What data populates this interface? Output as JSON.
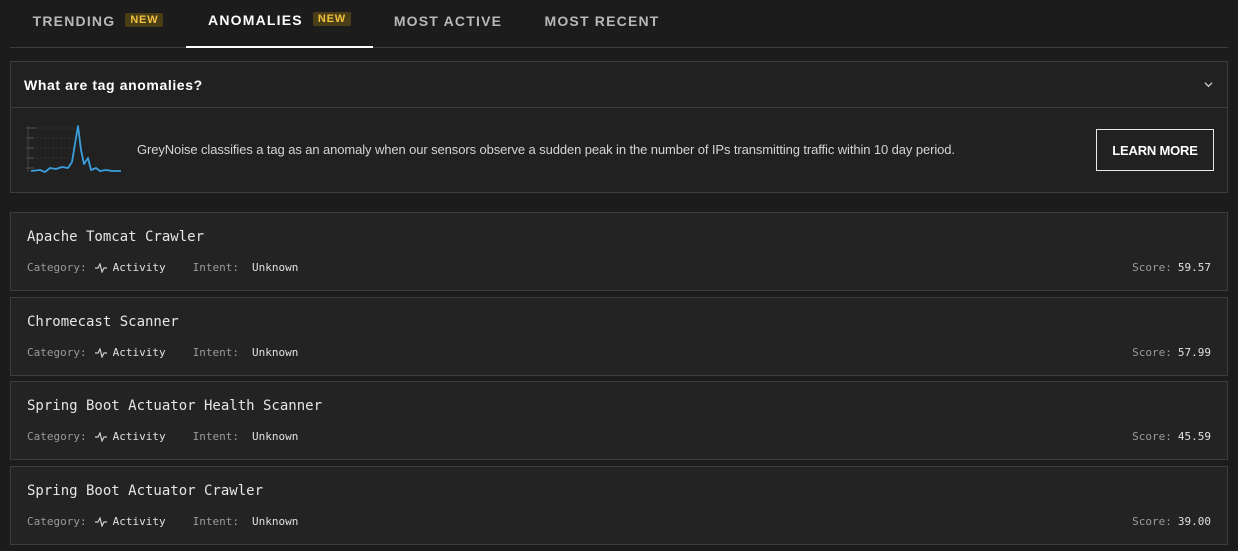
{
  "tabs": [
    {
      "label": "TRENDING",
      "badge": "NEW"
    },
    {
      "label": "ANOMALIES",
      "badge": "NEW"
    },
    {
      "label": "MOST ACTIVE"
    },
    {
      "label": "MOST RECENT"
    }
  ],
  "info": {
    "title": "What are tag anomalies?",
    "description": "GreyNoise classifies a tag as an anomaly when our sensors observe a sudden peak in the number of IPs transmitting traffic within 10 day period.",
    "button": "LEARN MORE",
    "icon": "spike-chart-icon",
    "accent": "#3b9ddd"
  },
  "labels": {
    "category": "Category:",
    "intent": "Intent:",
    "score": "Score:"
  },
  "cards": [
    {
      "title": "Apache Tomcat Crawler",
      "category": "Activity",
      "intent": "Unknown",
      "score": "59.57"
    },
    {
      "title": "Chromecast Scanner",
      "category": "Activity",
      "intent": "Unknown",
      "score": "57.99"
    },
    {
      "title": "Spring Boot Actuator Health Scanner",
      "category": "Activity",
      "intent": "Unknown",
      "score": "45.59"
    },
    {
      "title": "Spring Boot Actuator Crawler",
      "category": "Activity",
      "intent": "Unknown",
      "score": "39.00"
    }
  ],
  "colors": {
    "badge_bg": "#4a3e16",
    "badge_text": "#f0c040"
  }
}
